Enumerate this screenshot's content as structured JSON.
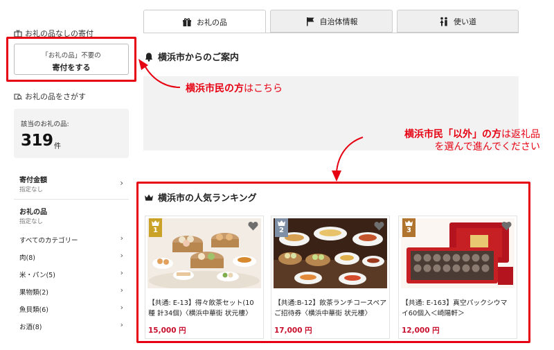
{
  "sidebar": {
    "no_gift_heading": "お礼の品なしの寄付",
    "no_gift_button_line1": "「お礼の品」不要の",
    "no_gift_button_line2": "寄付をする",
    "search_heading": "お礼の品をさがす",
    "count_label": "該当のお礼の品:",
    "count_value": "319",
    "count_unit": "件",
    "filters": [
      {
        "title": "寄付金額",
        "value": "指定なし"
      },
      {
        "title": "お礼の品",
        "value": "指定なし"
      }
    ],
    "categories": [
      {
        "label": "すべてのカテゴリー"
      },
      {
        "label": "肉(8)"
      },
      {
        "label": "米・パン(5)"
      },
      {
        "label": "果物類(2)"
      },
      {
        "label": "魚貝類(6)"
      },
      {
        "label": "お酒(8)"
      }
    ]
  },
  "tabs": [
    {
      "label": "お礼の品",
      "icon": "gift-icon",
      "active": true
    },
    {
      "label": "自治体情報",
      "icon": "flag-icon",
      "active": false
    },
    {
      "label": "使い道",
      "icon": "people-icon",
      "active": false
    }
  ],
  "main": {
    "notice_title": "横浜市からのご案内",
    "ranking_title": "横浜市の人気ランキング",
    "products": [
      {
        "rank": "1",
        "name": "【共通: E-13】得々飲茶セット(10種 計34個)〈横浜中華街 状元樓〉",
        "price": "15,000 円",
        "rank_color": "#c9a227"
      },
      {
        "rank": "2",
        "name": "【共通:B-12】飲茶ランチコースペアご招待券〈横浜中華街 状元樓〉",
        "price": "17,000 円",
        "rank_color": "#7f8fa6"
      },
      {
        "rank": "3",
        "name": "【共通: E-163】真空パックシウマイ60個入＜崎陽軒＞",
        "price": "12,000 円",
        "rank_color": "#b0742e"
      }
    ]
  },
  "annotations": {
    "residents_bold": "横浜市民の方",
    "residents_rest": "はこちら",
    "non_residents_bold": "横浜市民「以外」の方",
    "non_residents_rest1": "は返礼品",
    "non_residents_line2": "を選んで進んでください"
  },
  "colors": {
    "annotation_red": "#e60012",
    "price_red": "#c8102e"
  }
}
